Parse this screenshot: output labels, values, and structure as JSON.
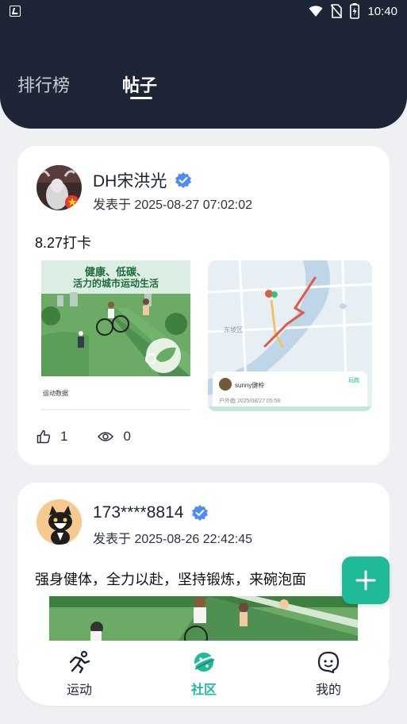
{
  "status_bar": {
    "time": "10:40"
  },
  "header": {
    "tabs": [
      {
        "label": "排行榜",
        "active": false
      },
      {
        "label": "帖子",
        "active": true
      }
    ]
  },
  "posts": [
    {
      "author": "DH宋洪光",
      "posted_at": "发表于 2025-08-27 07:02:02",
      "text": "8.27打卡",
      "images": [
        {
          "poster_title_line1": "健康、低碳、",
          "poster_title_line2": "活力的城市运动生活",
          "caption": "运动数据"
        },
        {
          "map_district": "东坡区",
          "user": "sunny健柃",
          "route_meta": "户外跑 2025/08/27 05:58",
          "badge": "玩跑"
        }
      ],
      "likes": "1",
      "views": "0"
    },
    {
      "author": "173****8814",
      "posted_at": "发表于 2025-08-26 22:42:45",
      "text": "强身健体，全力以赴，坚持锻炼，来碗泡面"
    }
  ],
  "bottom_nav": [
    {
      "label": "运动",
      "icon": "running-icon"
    },
    {
      "label": "社区",
      "icon": "planet-icon"
    },
    {
      "label": "我的",
      "icon": "face-icon"
    }
  ],
  "colors": {
    "header_bg": "#1d2536",
    "accent": "#1fba97",
    "verified": "#4a8ef5"
  }
}
